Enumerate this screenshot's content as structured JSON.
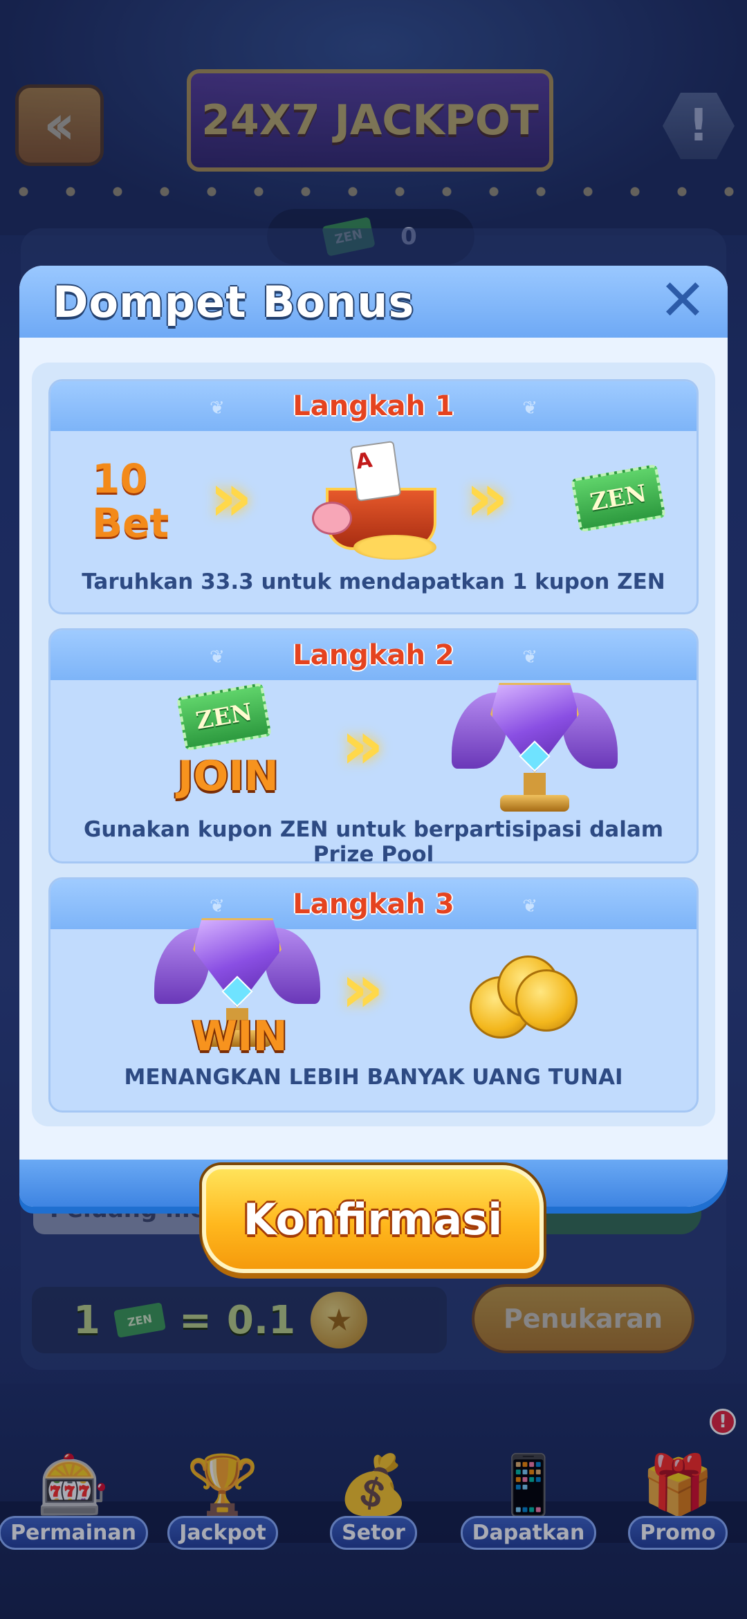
{
  "header": {
    "banner_title": "24X7 JACKPOT",
    "back_icon": "double-chevron-left-icon",
    "info_icon": "exclamation-icon",
    "info_glyph": "!",
    "zen_ticket_label": "ZEN",
    "zen_count": "0"
  },
  "background": {
    "peluang_text": "Peluang mena",
    "rate_left": "1",
    "rate_equals": "=",
    "rate_right": "0.1",
    "rate_ticket_label": "ZEN",
    "coin_glyph": "★",
    "exchange_button": "Penukaran"
  },
  "modal": {
    "title": "Dompet Bonus",
    "close_glyph": "✕",
    "steps": [
      {
        "title": "Langkah 1",
        "bet_number": "10",
        "bet_label": "Bet",
        "card_glyph": "A",
        "ticket_label": "ZEN",
        "description": "Taruhkan 33.3 untuk mendapatkan 1 kupon ZEN"
      },
      {
        "title": "Langkah 2",
        "ticket_label": "ZEN",
        "action_word": "JOIN",
        "description": "Gunakan kupon ZEN untuk berpartisipasi dalam Prize Pool"
      },
      {
        "title": "Langkah 3",
        "action_word": "WIN",
        "description": "MENANGKAN LEBIH BANYAK UANG TUNAI"
      }
    ],
    "arrow_glyph": "»",
    "ornament_glyph": "❦"
  },
  "confirm_button": "Konfirmasi",
  "bottom_nav": {
    "items": [
      {
        "label": "Permainan",
        "icon": "slot-machine-icon",
        "glyph": "🎰"
      },
      {
        "label": "Jackpot",
        "icon": "trophy-icon",
        "glyph": "🏆"
      },
      {
        "label": "Setor",
        "icon": "treasure-chest-icon",
        "glyph": "💰"
      },
      {
        "label": "Dapatkan",
        "icon": "phone-coins-icon",
        "glyph": "📱"
      },
      {
        "label": "Promo",
        "icon": "gift-box-icon",
        "glyph": "🎁"
      }
    ],
    "promo_badge": "!"
  },
  "colors": {
    "modal_header": "#7db4f8",
    "step_title": "#e5431f",
    "description": "#2d4a83",
    "confirm": "#ffb81e"
  }
}
